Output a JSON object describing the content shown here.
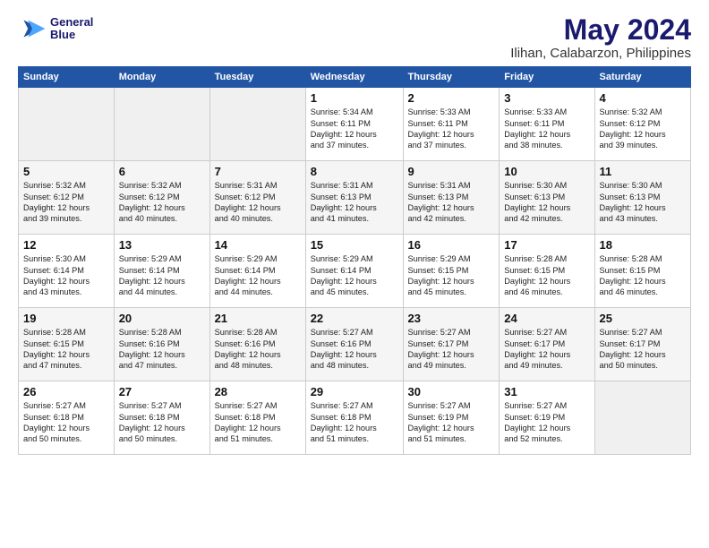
{
  "logo": {
    "line1": "General",
    "line2": "Blue"
  },
  "title": "May 2024",
  "subtitle": "Ilihan, Calabarzon, Philippines",
  "days_header": [
    "Sunday",
    "Monday",
    "Tuesday",
    "Wednesday",
    "Thursday",
    "Friday",
    "Saturday"
  ],
  "weeks": [
    [
      {
        "day": "",
        "info": ""
      },
      {
        "day": "",
        "info": ""
      },
      {
        "day": "",
        "info": ""
      },
      {
        "day": "1",
        "info": "Sunrise: 5:34 AM\nSunset: 6:11 PM\nDaylight: 12 hours\nand 37 minutes."
      },
      {
        "day": "2",
        "info": "Sunrise: 5:33 AM\nSunset: 6:11 PM\nDaylight: 12 hours\nand 37 minutes."
      },
      {
        "day": "3",
        "info": "Sunrise: 5:33 AM\nSunset: 6:11 PM\nDaylight: 12 hours\nand 38 minutes."
      },
      {
        "day": "4",
        "info": "Sunrise: 5:32 AM\nSunset: 6:12 PM\nDaylight: 12 hours\nand 39 minutes."
      }
    ],
    [
      {
        "day": "5",
        "info": "Sunrise: 5:32 AM\nSunset: 6:12 PM\nDaylight: 12 hours\nand 39 minutes."
      },
      {
        "day": "6",
        "info": "Sunrise: 5:32 AM\nSunset: 6:12 PM\nDaylight: 12 hours\nand 40 minutes."
      },
      {
        "day": "7",
        "info": "Sunrise: 5:31 AM\nSunset: 6:12 PM\nDaylight: 12 hours\nand 40 minutes."
      },
      {
        "day": "8",
        "info": "Sunrise: 5:31 AM\nSunset: 6:13 PM\nDaylight: 12 hours\nand 41 minutes."
      },
      {
        "day": "9",
        "info": "Sunrise: 5:31 AM\nSunset: 6:13 PM\nDaylight: 12 hours\nand 42 minutes."
      },
      {
        "day": "10",
        "info": "Sunrise: 5:30 AM\nSunset: 6:13 PM\nDaylight: 12 hours\nand 42 minutes."
      },
      {
        "day": "11",
        "info": "Sunrise: 5:30 AM\nSunset: 6:13 PM\nDaylight: 12 hours\nand 43 minutes."
      }
    ],
    [
      {
        "day": "12",
        "info": "Sunrise: 5:30 AM\nSunset: 6:14 PM\nDaylight: 12 hours\nand 43 minutes."
      },
      {
        "day": "13",
        "info": "Sunrise: 5:29 AM\nSunset: 6:14 PM\nDaylight: 12 hours\nand 44 minutes."
      },
      {
        "day": "14",
        "info": "Sunrise: 5:29 AM\nSunset: 6:14 PM\nDaylight: 12 hours\nand 44 minutes."
      },
      {
        "day": "15",
        "info": "Sunrise: 5:29 AM\nSunset: 6:14 PM\nDaylight: 12 hours\nand 45 minutes."
      },
      {
        "day": "16",
        "info": "Sunrise: 5:29 AM\nSunset: 6:15 PM\nDaylight: 12 hours\nand 45 minutes."
      },
      {
        "day": "17",
        "info": "Sunrise: 5:28 AM\nSunset: 6:15 PM\nDaylight: 12 hours\nand 46 minutes."
      },
      {
        "day": "18",
        "info": "Sunrise: 5:28 AM\nSunset: 6:15 PM\nDaylight: 12 hours\nand 46 minutes."
      }
    ],
    [
      {
        "day": "19",
        "info": "Sunrise: 5:28 AM\nSunset: 6:15 PM\nDaylight: 12 hours\nand 47 minutes."
      },
      {
        "day": "20",
        "info": "Sunrise: 5:28 AM\nSunset: 6:16 PM\nDaylight: 12 hours\nand 47 minutes."
      },
      {
        "day": "21",
        "info": "Sunrise: 5:28 AM\nSunset: 6:16 PM\nDaylight: 12 hours\nand 48 minutes."
      },
      {
        "day": "22",
        "info": "Sunrise: 5:27 AM\nSunset: 6:16 PM\nDaylight: 12 hours\nand 48 minutes."
      },
      {
        "day": "23",
        "info": "Sunrise: 5:27 AM\nSunset: 6:17 PM\nDaylight: 12 hours\nand 49 minutes."
      },
      {
        "day": "24",
        "info": "Sunrise: 5:27 AM\nSunset: 6:17 PM\nDaylight: 12 hours\nand 49 minutes."
      },
      {
        "day": "25",
        "info": "Sunrise: 5:27 AM\nSunset: 6:17 PM\nDaylight: 12 hours\nand 50 minutes."
      }
    ],
    [
      {
        "day": "26",
        "info": "Sunrise: 5:27 AM\nSunset: 6:18 PM\nDaylight: 12 hours\nand 50 minutes."
      },
      {
        "day": "27",
        "info": "Sunrise: 5:27 AM\nSunset: 6:18 PM\nDaylight: 12 hours\nand 50 minutes."
      },
      {
        "day": "28",
        "info": "Sunrise: 5:27 AM\nSunset: 6:18 PM\nDaylight: 12 hours\nand 51 minutes."
      },
      {
        "day": "29",
        "info": "Sunrise: 5:27 AM\nSunset: 6:18 PM\nDaylight: 12 hours\nand 51 minutes."
      },
      {
        "day": "30",
        "info": "Sunrise: 5:27 AM\nSunset: 6:19 PM\nDaylight: 12 hours\nand 51 minutes."
      },
      {
        "day": "31",
        "info": "Sunrise: 5:27 AM\nSunset: 6:19 PM\nDaylight: 12 hours\nand 52 minutes."
      },
      {
        "day": "",
        "info": ""
      }
    ]
  ]
}
